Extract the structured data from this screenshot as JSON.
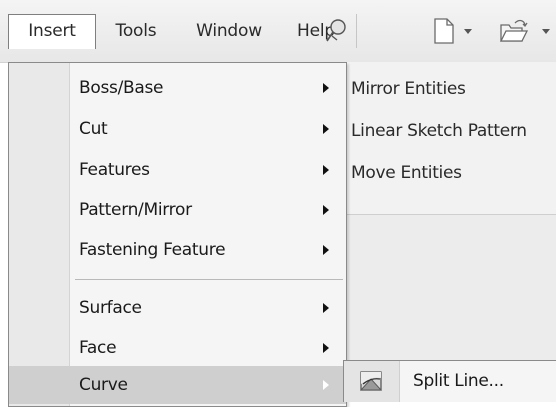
{
  "menubar": {
    "items": [
      {
        "label": "Insert"
      },
      {
        "label": "Tools"
      },
      {
        "label": "Window"
      },
      {
        "label": "Help"
      }
    ],
    "icons": [
      "pin-icon",
      "new-document-icon",
      "dropdown-arrow-icon",
      "open-folder-icon",
      "dropdown-arrow-icon"
    ]
  },
  "insert_menu": {
    "items": [
      {
        "label": "Boss/Base",
        "has_submenu": true
      },
      {
        "label": "Cut",
        "has_submenu": true
      },
      {
        "label": "Features",
        "has_submenu": true
      },
      {
        "label": "Pattern/Mirror",
        "has_submenu": true
      },
      {
        "label": "Fastening Feature",
        "has_submenu": true
      },
      {
        "label": "Surface",
        "has_submenu": true
      },
      {
        "label": "Face",
        "has_submenu": true
      },
      {
        "label": "Curve",
        "has_submenu": true,
        "highlighted": true
      }
    ]
  },
  "curve_submenu": {
    "items": [
      {
        "label": "Split Line...",
        "icon": "split-line-icon"
      }
    ]
  },
  "background_toolbar": {
    "entries": [
      {
        "label": "Mirror Entities"
      },
      {
        "label": "Linear Sketch Pattern"
      },
      {
        "label": "Move Entities"
      }
    ]
  },
  "colors": {
    "menu_bg": "#f5f5f5",
    "highlight": "#cfcfcf",
    "gutter": "#e9e9e9"
  }
}
